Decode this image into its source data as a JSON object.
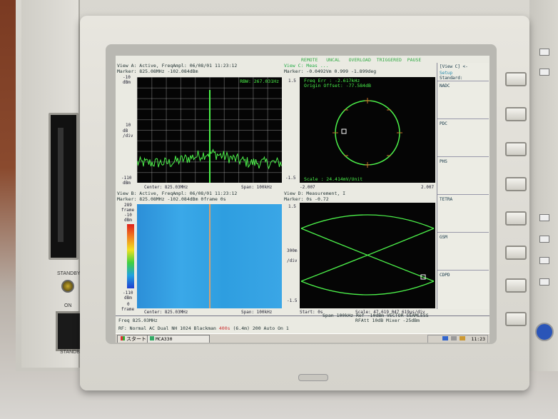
{
  "instrument": {
    "standby_label": "STANDBY",
    "on_label": "ON",
    "standby_label_2": "STANDBY"
  },
  "top_bar": {
    "items": [
      "REMOTE",
      "UNCAL",
      "OVERLOAD",
      "TRIGGERED",
      "PAUSE"
    ]
  },
  "view_a": {
    "title": "View A: Active, FreqAmpl: 06/08/01 11:23:12",
    "marker": "Marker: 825.08MHz   -102.084dBm",
    "rbw": "RBW: 267.031Hz",
    "y_top": "-10",
    "y_top_unit": "dBm",
    "y_mid": "10",
    "y_mid_unit": "dB\n/div",
    "y_bot": "-110",
    "y_bot_unit": "dBm",
    "center": "Center: 825.03MHz",
    "span": "Span: 100kHz"
  },
  "view_b": {
    "title": "View B: Active, FreqAmpl: 06/08/01 11:23:12",
    "marker": "Marker: 825.08MHz   -102.084dBm   0frame   0s",
    "top_frame": "289",
    "top_frame_unit": "frame",
    "scale_top": "-10",
    "scale_top_unit": "dBm",
    "scale_bot": "-110",
    "scale_bot_unit": "dBm",
    "bot_frame": "0",
    "bot_frame_unit": "frame",
    "center": "Center: 825.03MHz",
    "span": "Span: 100kHz"
  },
  "view_c": {
    "title": "View C: Meas ...",
    "marker": "Marker: -0.0492Vm   0.999   -1.899deg",
    "y_top": "1.5",
    "y_bot": "-1.5",
    "freq_err": "Freq Err    : -2.617kHz",
    "origin_offset": "Origin Offset: -77.584dB",
    "scale": "Scale   : 24.414mV/Unit",
    "x_left": "-2.007",
    "x_right": "2.007"
  },
  "view_d": {
    "title": "View D: Measurement, I",
    "marker": "Marker: 0s   -0.72",
    "y_top": "1.5",
    "y_mid": "300m",
    "y_mid_unit": "/div",
    "y_bot": "-1.5",
    "start": "Start: 0s",
    "scale": "Scale: 47.619 047 619μs/div"
  },
  "soft_menu": {
    "header": "[View C] <-",
    "items": [
      "Setup",
      "Standard:",
      "NADC",
      "PDC",
      "PHS",
      "TETRA",
      "GSM",
      "CDPD",
      ""
    ]
  },
  "status": {
    "freq": "Freq 825.03MHz",
    "line2": "Span 100kHz  Ref -10dBm   VECTOR  SEAMLESS",
    "line3": "RFAtt 10dB       Mixer -25dBm",
    "rf": "RF: Normal AC Dual NH 1024 Blackman",
    "rf_red": "400s",
    "rf_tail": "(6.4m) 200 Auto On 1"
  },
  "taskbar": {
    "start": "スタート",
    "task": "MCA330",
    "clock": "11:23"
  },
  "colors": {
    "trace": "#4cf24a",
    "spectrogram": "#2b9ae0",
    "marker": "#ffffff"
  }
}
